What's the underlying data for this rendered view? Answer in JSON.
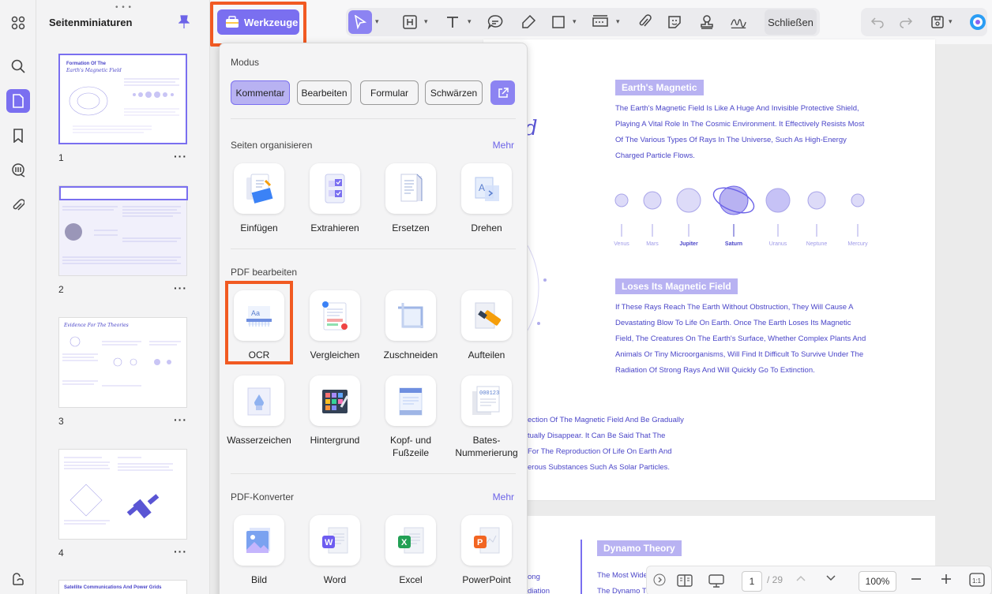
{
  "thumbnails": {
    "title": "Seitenminiaturen",
    "pages": [
      {
        "num": "1",
        "title": "Formation Of The",
        "subtitle": "Earth's Magnetic Field"
      },
      {
        "num": "2"
      },
      {
        "num": "3",
        "title": "Evidence For The Theories"
      },
      {
        "num": "4"
      },
      {
        "num": "",
        "title": "Satellite Communications And Power Grids"
      }
    ],
    "more": "···"
  },
  "toolbar": {
    "werkzeuge_label": "Werkzeuge",
    "close_label": "Schließen"
  },
  "panel": {
    "modus_title": "Modus",
    "modes": [
      "Kommentar",
      "Bearbeiten",
      "Formular",
      "Schwärzen"
    ],
    "organize_title": "Seiten organisieren",
    "organize_more": "Mehr",
    "organize_tools": [
      "Einfügen",
      "Extrahieren",
      "Ersetzen",
      "Drehen"
    ],
    "edit_title": "PDF bearbeiten",
    "edit_tools_row1": [
      "OCR",
      "Vergleichen",
      "Zuschneiden",
      "Aufteilen"
    ],
    "edit_tools_row2": [
      "Wasserzeichen",
      "Hintergrund",
      "Kopf- und Fußzeile",
      "Bates-Nummerierung"
    ],
    "convert_title": "PDF-Konverter",
    "convert_more": "Mehr",
    "convert_tools": [
      "Bild",
      "Word",
      "Excel",
      "PowerPoint"
    ]
  },
  "document": {
    "big_letter": "d",
    "heading1": "Earth's Magnetic",
    "para1": [
      "The Earth's Magnetic Field Is Like A Huge And Invisible Protective Shield,",
      "Playing A Vital Role In The Cosmic Environment. It Effectively Resists Most",
      "Of The Various Types Of Rays In The Universe, Such As High-Energy",
      "Charged Particle Flows."
    ],
    "planets": [
      "Venus",
      "Mars",
      "Jupiter",
      "Saturn",
      "Uranus",
      "Neptune",
      "Mercury"
    ],
    "heading2": "Loses Its Magnetic Field",
    "para2": [
      "If These Rays Reach The Earth Without Obstruction, They Will Cause A",
      "Devastating Blow To Life On Earth. Once The Earth Loses Its Magnetic",
      "Field, The Creatures On The Earth's Surface, Whether Complex Plants And",
      "Animals Or Tiny Microorganisms, Will Find It Difficult To Survive Under The",
      "Radiation Of Strong Rays And Will Quickly Go To Extinction."
    ],
    "para3": [
      "ection Of The Magnetic Field And Be Gradually",
      "tually Disappear. It Can Be Said That The",
      "For The Reproduction Of Life On Earth And",
      "erous Substances Such As Solar Particles."
    ],
    "heading3": "Dynamo Theory",
    "para4": [
      "The Most Wide",
      "The Dynamo T"
    ],
    "frag1": "ong",
    "frag2": "diation"
  },
  "pagenav": {
    "current": "1",
    "total": "/ 29",
    "zoom": "100%"
  }
}
